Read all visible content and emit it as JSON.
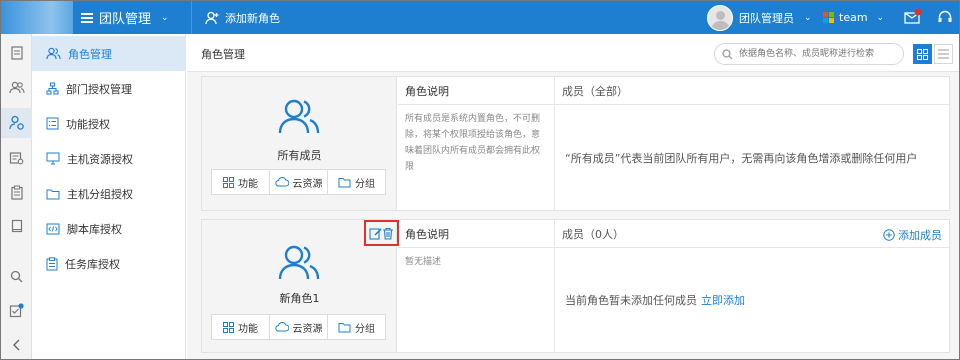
{
  "topbar": {
    "team_title": "团队管理",
    "add_role_label": "添加新角色",
    "user_name": "团队管理员",
    "team_name": "team",
    "bg_color": "#1e7fd1"
  },
  "subnav": {
    "items": [
      {
        "label": "角色管理",
        "icon": "users-icon"
      },
      {
        "label": "部门授权管理",
        "icon": "org-chart-icon"
      },
      {
        "label": "功能授权",
        "icon": "function-list-icon"
      },
      {
        "label": "主机资源授权",
        "icon": "monitor-icon"
      },
      {
        "label": "主机分组授权",
        "icon": "folder-icon"
      },
      {
        "label": "脚本库授权",
        "icon": "script-icon"
      },
      {
        "label": "任务库授权",
        "icon": "clipboard-icon"
      }
    ]
  },
  "main": {
    "breadcrumb": "角色管理",
    "search_placeholder": "依据角色名称、成员昵称进行检索"
  },
  "roles": [
    {
      "name": "所有成员",
      "desc_header": "角色说明",
      "member_header": "成员（全部）",
      "description": "所有成员是系统内置角色，不可删除，将某个权限项授给该角色，意味着团队内所有成员都会拥有此权限",
      "members_text": "“所有成员”代表当前团队所有用户，无需再向该角色增添或删除任何用户",
      "buttons": {
        "function": "功能",
        "cloud": "云资源",
        "group": "分组"
      }
    },
    {
      "name": "新角色1",
      "desc_header": "角色说明",
      "member_header": "成员（0人）",
      "description": "暂无描述",
      "members_text": "当前角色暂未添加任何成员",
      "add_now_link": "立即添加",
      "add_member_label": "添加成员",
      "buttons": {
        "function": "功能",
        "cloud": "云资源",
        "group": "分组"
      }
    }
  ]
}
